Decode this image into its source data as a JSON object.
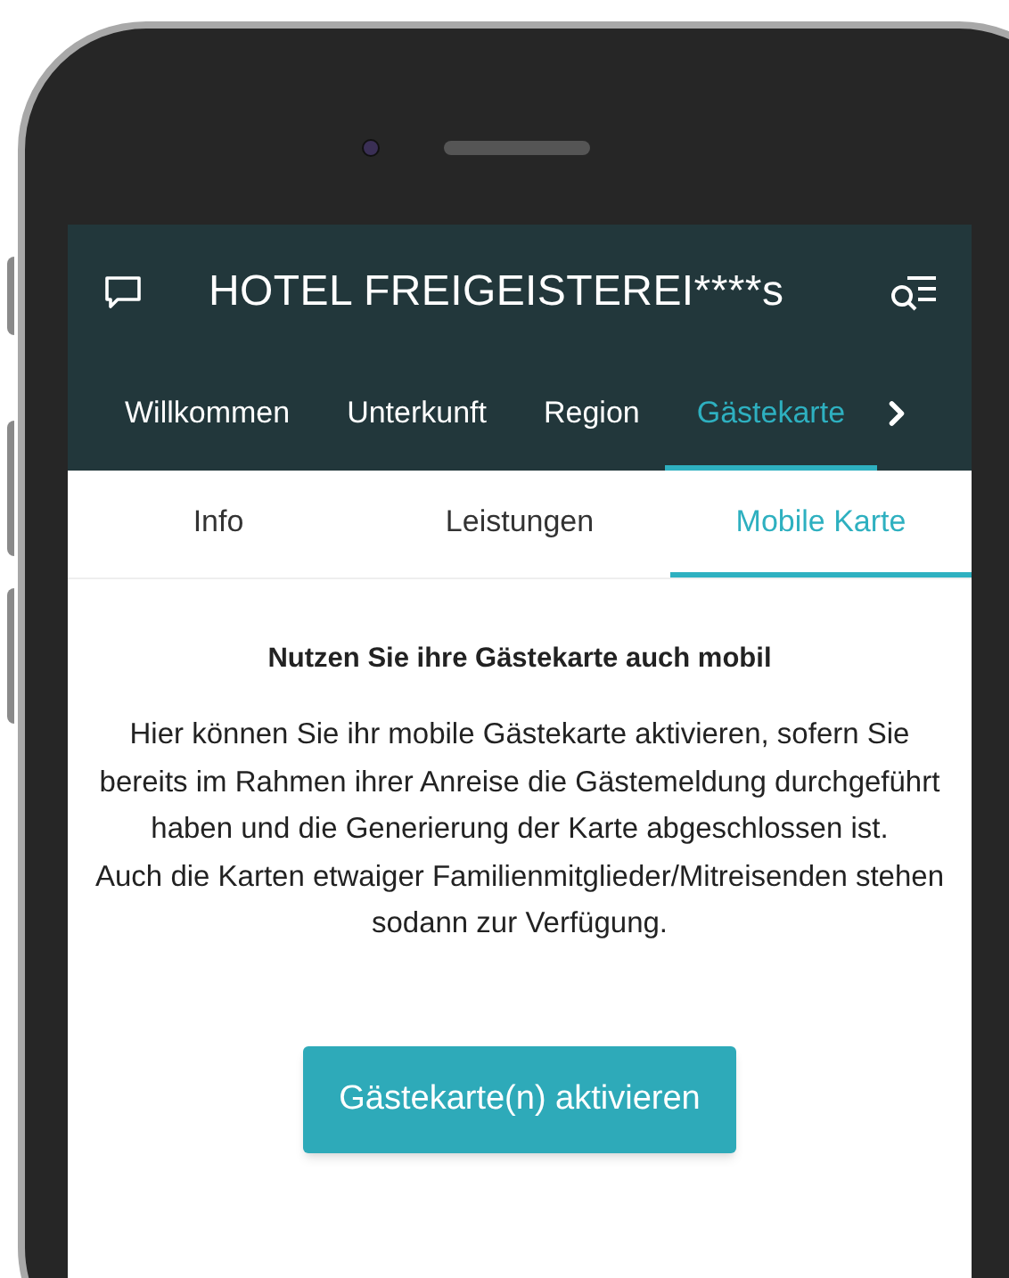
{
  "header": {
    "title": "HOTEL FREIGEISTEREI****s"
  },
  "nav_tabs": [
    {
      "label": "Willkommen",
      "selected": false
    },
    {
      "label": "Unterkunft",
      "selected": false
    },
    {
      "label": "Region",
      "selected": false
    },
    {
      "label": "Gästekarte",
      "selected": true
    }
  ],
  "sub_tabs": [
    {
      "label": "Info",
      "selected": false
    },
    {
      "label": "Leistungen",
      "selected": false
    },
    {
      "label": "Mobile Karte",
      "selected": true
    }
  ],
  "content": {
    "heading": "Nutzen Sie ihre Gästekarte auch mobil",
    "paragraphs": [
      "Hier können Sie ihr mobile Gästekarte aktivieren, sofern Sie bereits im Rahmen ihrer Anreise die Gästemeldung durchgeführt haben und die Generierung der Karte abgeschlossen ist.",
      "Auch die Karten etwaiger Familienmitglieder/Mitreisenden stehen sodann zur Verfügung."
    ],
    "button": "Gästekarte(n) aktivieren"
  }
}
